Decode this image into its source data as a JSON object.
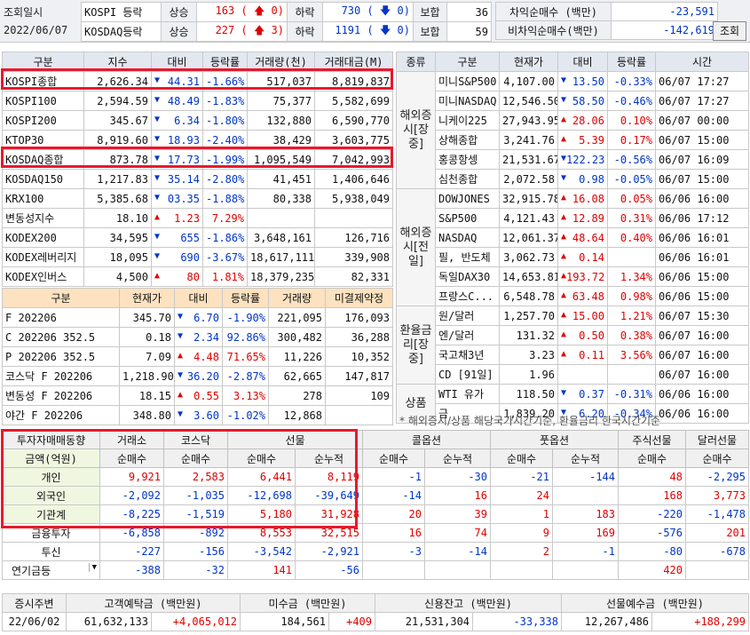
{
  "header": {
    "date_label": "조회일시",
    "date_value": "2022/06/07",
    "lookup_button": "조회",
    "markets": [
      {
        "name": "KOSPI 등락",
        "up_label": "상승",
        "up": "163",
        "upper_limit": "0",
        "down_label": "하락",
        "down": "730",
        "lower_limit": "0",
        "flat_label": "보합",
        "flat": "36"
      },
      {
        "name": "KOSDAQ등락",
        "up_label": "상승",
        "up": "227",
        "upper_limit": "3",
        "down_label": "하락",
        "down": "1191",
        "lower_limit": "0",
        "flat_label": "보합",
        "flat": "59"
      }
    ],
    "program": [
      {
        "label": "차익순매수 (백만)",
        "value": "-23,591"
      },
      {
        "label": "비차익순매수(백만)",
        "value": "-142,619"
      }
    ]
  },
  "index_table": {
    "headers": [
      "구분",
      "지수",
      "대비",
      "등락률",
      "거래량(천)",
      "거래대금(M)"
    ],
    "rows": [
      {
        "name": "KOSPI종합",
        "value": "2,626.34",
        "dir": "down",
        "change": "44.31",
        "rate": "-1.66%",
        "volume": "517,037",
        "amount": "8,819,837"
      },
      {
        "name": "KOSPI100",
        "value": "2,594.59",
        "dir": "down",
        "change": "48.49",
        "rate": "-1.83%",
        "volume": "75,377",
        "amount": "5,582,699"
      },
      {
        "name": "KOSPI200",
        "value": "345.67",
        "dir": "down",
        "change": "6.34",
        "rate": "-1.80%",
        "volume": "132,880",
        "amount": "6,590,770"
      },
      {
        "name": "KTOP30",
        "value": "8,919.60",
        "dir": "down",
        "change": "18.93",
        "rate": "-2.40%",
        "volume": "38,429",
        "amount": "3,603,775"
      },
      {
        "name": "KOSDAQ종합",
        "value": "873.78",
        "dir": "down",
        "change": "17.73",
        "rate": "-1.99%",
        "volume": "1,095,549",
        "amount": "7,042,993"
      },
      {
        "name": "KOSDAQ150",
        "value": "1,217.83",
        "dir": "down",
        "change": "35.14",
        "rate": "-2.80%",
        "volume": "41,451",
        "amount": "1,406,646"
      },
      {
        "name": "KRX100",
        "value": "5,385.68",
        "dir": "down",
        "change": "03.35",
        "rate": "-1.88%",
        "volume": "80,338",
        "amount": "5,938,049"
      },
      {
        "name": "변동성지수",
        "value": "18.10",
        "dir": "up",
        "change": "1.23",
        "rate": "7.29%",
        "volume": "",
        "amount": ""
      },
      {
        "name": "KODEX200",
        "value": "34,595",
        "dir": "down",
        "change": "655",
        "rate": "-1.86%",
        "volume": "3,648,161",
        "amount": "126,716"
      },
      {
        "name": "KODEX레버리지",
        "value": "18,095",
        "dir": "down",
        "change": "690",
        "rate": "-3.67%",
        "volume": "18,617,111",
        "amount": "339,908"
      },
      {
        "name": "KODEX인버스",
        "value": "4,500",
        "dir": "up",
        "change": "80",
        "rate": "1.81%",
        "volume": "18,379,235",
        "amount": "82,331"
      }
    ]
  },
  "futures_table": {
    "headers": [
      "구분",
      "현재가",
      "대비",
      "등락률",
      "거래량",
      "미결제약정"
    ],
    "rows": [
      {
        "name": "F 202206",
        "price": "345.70",
        "dir": "down",
        "change": "6.70",
        "rate": "-1.90%",
        "volume": "221,095",
        "oi": "176,093"
      },
      {
        "name": "C 202206 352.5",
        "price": "0.18",
        "dir": "down",
        "change": "2.34",
        "rate": "92.86%",
        "volume": "300,482",
        "oi": "36,288"
      },
      {
        "name": "P 202206 352.5",
        "price": "7.09",
        "dir": "up",
        "change": "4.48",
        "rate": "71.65%",
        "volume": "11,226",
        "oi": "10,352"
      },
      {
        "name": "코스닥 F 202206",
        "price": "1,218.90",
        "dir": "down",
        "change": "36.20",
        "rate": "-2.87%",
        "volume": "62,665",
        "oi": "147,817"
      },
      {
        "name": "변동성 F 202206",
        "price": "18.15",
        "dir": "up",
        "change": "0.55",
        "rate": "3.13%",
        "volume": "278",
        "oi": "109"
      },
      {
        "name": "야간 F 202206",
        "price": "348.80",
        "dir": "down",
        "change": "3.60",
        "rate": "-1.02%",
        "volume": "12,868",
        "oi": ""
      }
    ]
  },
  "overseas_table": {
    "headers": [
      "종류",
      "구분",
      "현재가",
      "대비",
      "등락률",
      "시간"
    ],
    "groups": [
      {
        "category": "해외증시[장중]",
        "rows": [
          {
            "name": "미니S&P500",
            "price": "4,107.00",
            "dir": "down",
            "change": "13.50",
            "rate": "-0.33%",
            "time": "06/07 17:27"
          },
          {
            "name": "미니NASDAQ",
            "price": "12,546.50",
            "dir": "down",
            "change": "58.50",
            "rate": "-0.46%",
            "time": "06/07 17:27"
          },
          {
            "name": "니케이225",
            "price": "27,943.95",
            "dir": "up",
            "change": "28.06",
            "rate": "0.10%",
            "time": "06/07 00:00"
          },
          {
            "name": "상해종합",
            "price": "3,241.76",
            "dir": "up",
            "change": "5.39",
            "rate": "0.17%",
            "time": "06/07 15:00"
          },
          {
            "name": "홍콩항셍",
            "price": "21,531.67",
            "dir": "down",
            "change": "122.23",
            "rate": "-0.56%",
            "time": "06/07 16:09"
          },
          {
            "name": "심천종합",
            "price": "2,072.58",
            "dir": "down",
            "change": "0.98",
            "rate": "-0.05%",
            "time": "06/07 15:00"
          }
        ]
      },
      {
        "category": "해외증시[전일]",
        "rows": [
          {
            "name": "DOWJONES",
            "price": "32,915.78",
            "dir": "up",
            "change": "16.08",
            "rate": "0.05%",
            "time": "06/06 16:00"
          },
          {
            "name": "S&P500",
            "price": "4,121.43",
            "dir": "up",
            "change": "12.89",
            "rate": "0.31%",
            "time": "06/06 17:12"
          },
          {
            "name": "NASDAQ",
            "price": "12,061.37",
            "dir": "up",
            "change": "48.64",
            "rate": "0.40%",
            "time": "06/06 16:01"
          },
          {
            "name": "필, 반도체",
            "price": "3,062.73",
            "dir": "up",
            "change": "0.14",
            "rate": "",
            "time": "06/06 16:01"
          },
          {
            "name": "독일DAX30",
            "price": "14,653.81",
            "dir": "up",
            "change": "193.72",
            "rate": "1.34%",
            "time": "06/06 15:00"
          },
          {
            "name": "프랑스C...",
            "price": "6,548.78",
            "dir": "up",
            "change": "63.48",
            "rate": "0.98%",
            "time": "06/06 15:00"
          }
        ]
      },
      {
        "category": "환율금리[장중]",
        "rows": [
          {
            "name": "원/달러",
            "price": "1,257.70",
            "dir": "up",
            "change": "15.00",
            "rate": "1.21%",
            "time": "06/07 15:30"
          },
          {
            "name": "엔/달러",
            "price": "131.32",
            "dir": "up",
            "change": "0.50",
            "rate": "0.38%",
            "time": "06/07 16:00"
          },
          {
            "name": "국고채3년",
            "price": "3.23",
            "dir": "up",
            "change": "0.11",
            "rate": "3.56%",
            "time": "06/07 16:00"
          },
          {
            "name": "CD [91일]",
            "price": "1.96",
            "dir": "",
            "change": "",
            "rate": "",
            "time": "06/07 16:00"
          }
        ]
      },
      {
        "category": "상품",
        "rows": [
          {
            "name": "WTI 유가",
            "price": "118.50",
            "dir": "down",
            "change": "0.37",
            "rate": "-0.31%",
            "time": "06/06 16:00"
          },
          {
            "name": "금",
            "price": "1,839.20",
            "dir": "down",
            "change": "6.20",
            "rate": "-0.34%",
            "time": "06/06 16:00"
          }
        ]
      }
    ],
    "note": "* 해외증시/상품 해당국가시간기준, 환율금리 한국시간기준"
  },
  "investor_table": {
    "title": "투자자매매동향",
    "unit": "금액(억원)",
    "group_headers": [
      "거래소",
      "코스닥",
      "선물",
      "콜옵션",
      "풋옵션",
      "주식선물",
      "달러선물"
    ],
    "sub_headers": [
      "순매수",
      "순매수",
      "순매수",
      "순누적",
      "순매수",
      "순누적",
      "순매수",
      "순누적",
      "순매수",
      "순매수"
    ],
    "rows": [
      {
        "name": "개인",
        "values": [
          "9,921",
          "2,583",
          "6,441",
          "8,119",
          "-1",
          "-30",
          "-21",
          "-144",
          "48",
          "-2,295"
        ]
      },
      {
        "name": "외국인",
        "values": [
          "-2,092",
          "-1,035",
          "-12,698",
          "-39,649",
          "-14",
          "16",
          "24",
          "",
          "168",
          "3,773"
        ]
      },
      {
        "name": "기관계",
        "values": [
          "-8,225",
          "-1,519",
          "5,180",
          "31,928",
          "20",
          "39",
          "1",
          "183",
          "-220",
          "-1,478"
        ]
      },
      {
        "name": "금융투자",
        "values": [
          "-6,858",
          "-892",
          "8,553",
          "32,515",
          "16",
          "74",
          "9",
          "169",
          "-576",
          "201"
        ]
      },
      {
        "name": "투신",
        "values": [
          "-227",
          "-156",
          "-3,542",
          "-2,921",
          "-3",
          "-14",
          "2",
          "-1",
          "-80",
          "-678"
        ]
      },
      {
        "name": "연기금등",
        "values": [
          "-388",
          "-32",
          "141",
          "-56",
          "",
          "",
          "",
          "",
          "420",
          ""
        ]
      }
    ]
  },
  "bottom_table": {
    "headers": [
      "증시주변",
      "고객예탁금 (백만원)",
      "미수금 (백만원)",
      "신용잔고 (백만원)",
      "선물예수금 (백만원)"
    ],
    "date": "22/06/02",
    "values": [
      {
        "value": "61,632,133",
        "change": "+4,065,012"
      },
      {
        "value": "184,561",
        "change": "+409"
      },
      {
        "value": "21,531,304",
        "change": "-33,338"
      },
      {
        "value": "12,267,486",
        "change": "+188,299"
      }
    ]
  },
  "colors": {
    "up": "#e00000",
    "down": "#0035c8",
    "highlight": "#e8192c"
  }
}
